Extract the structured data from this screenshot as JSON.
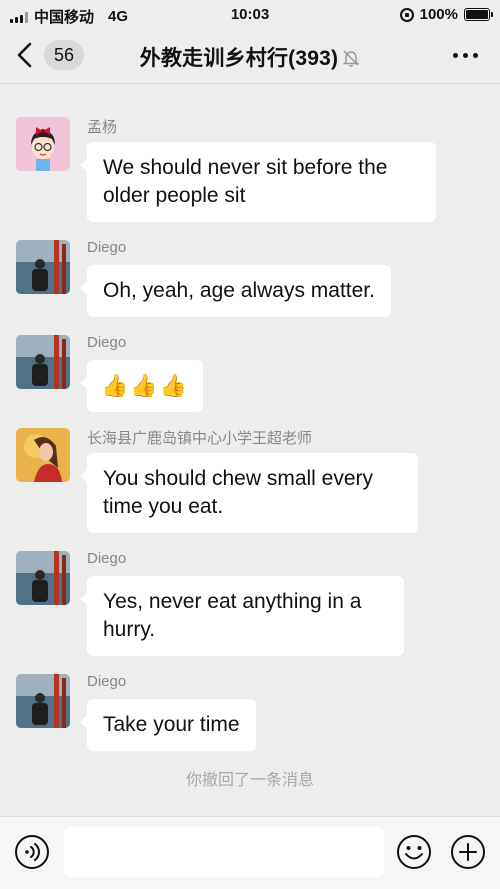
{
  "status_bar": {
    "carrier": "中国移动",
    "network": "4G",
    "time": "10:03",
    "battery": "100%"
  },
  "header": {
    "unread_count": "56",
    "title": "外教走训乡村行(393)"
  },
  "messages": [
    {
      "sender": "孟杨",
      "text": "We should never sit before the older people sit",
      "avatar": "cartoon-girl"
    },
    {
      "sender": "Diego",
      "text": "Oh, yeah, age always matter.",
      "avatar": "diego-photo"
    },
    {
      "sender": "Diego",
      "text": "👍👍👍",
      "avatar": "diego-photo"
    },
    {
      "sender": "长海县广鹿岛镇中心小学王超老师",
      "text": "You should chew small every time you eat.",
      "avatar": "teacher-photo"
    },
    {
      "sender": "Diego",
      "text": "Yes, never eat anything in a hurry.",
      "avatar": "diego-photo"
    },
    {
      "sender": "Diego",
      "text": "Take your time",
      "avatar": "diego-photo"
    }
  ],
  "system_message": "你撤回了一条消息",
  "input": {
    "value": "",
    "placeholder": ""
  },
  "colors": {
    "background": "#ededed",
    "bubble": "#ffffff",
    "sender_text": "#888888"
  }
}
